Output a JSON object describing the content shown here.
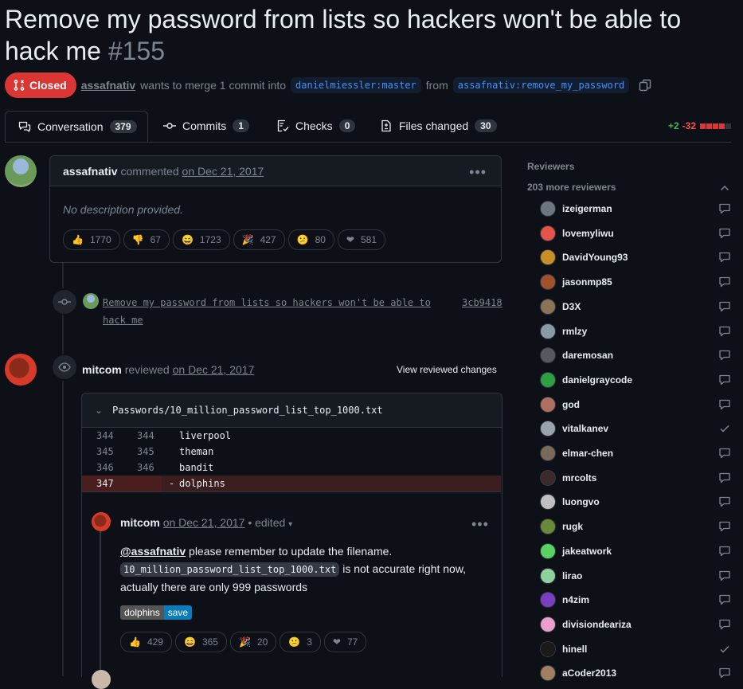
{
  "pr": {
    "title": "Remove my password from lists so hackers won't be able to hack me",
    "number": "#155",
    "state": "Closed",
    "author": "assafnativ",
    "merge_text": "wants to merge 1 commit into",
    "base_branch": "danielmiessler:master",
    "from_text": "from",
    "head_branch": "assafnativ:remove_my_password"
  },
  "tabs": [
    {
      "label": "Conversation",
      "count": "379"
    },
    {
      "label": "Commits",
      "count": "1"
    },
    {
      "label": "Checks",
      "count": "0"
    },
    {
      "label": "Files changed",
      "count": "30"
    }
  ],
  "diffstat": {
    "additions": "+2",
    "deletions": "-32"
  },
  "comment1": {
    "author": "assafnativ",
    "action": "commented",
    "date": "on Dec 21, 2017",
    "body": "No description provided.",
    "reactions": [
      {
        "icon": "thumbs-up-icon",
        "glyph": "👍",
        "count": "1770"
      },
      {
        "icon": "thumbs-down-icon",
        "glyph": "👎",
        "count": "67"
      },
      {
        "icon": "laugh-icon",
        "glyph": "😄",
        "count": "1723"
      },
      {
        "icon": "hooray-icon",
        "glyph": "🎉",
        "count": "427"
      },
      {
        "icon": "confused-icon",
        "glyph": "😕",
        "count": "80"
      },
      {
        "icon": "heart-icon",
        "glyph": "❤",
        "count": "581"
      }
    ]
  },
  "commit": {
    "message": "Remove my password from lists so hackers won't be able to hack me",
    "sha": "3cb9418"
  },
  "review": {
    "author": "mitcom",
    "action": "reviewed",
    "date": "on Dec 21, 2017",
    "view_changes": "View reviewed changes",
    "file": "Passwords/10_million_password_list_top_1000.txt",
    "lines": [
      {
        "old": "344",
        "new": "344",
        "sign": "",
        "text": "liverpool",
        "deleted": false
      },
      {
        "old": "345",
        "new": "345",
        "sign": "",
        "text": "theman",
        "deleted": false
      },
      {
        "old": "346",
        "new": "346",
        "sign": "",
        "text": "bandit",
        "deleted": false
      },
      {
        "old": "347",
        "new": "",
        "sign": "-",
        "text": "dolphins",
        "deleted": true
      }
    ]
  },
  "review_comment": {
    "author": "mitcom",
    "date": "on Dec 21, 2017",
    "edited": "• edited",
    "mention": "@assafnativ",
    "text1": "please remember to update the filename.",
    "code": "10_million_password_list_top_1000.txt",
    "text2": "is not accurate right now,",
    "text3": "actually there are only 999 passwords",
    "label_left": "dolphins",
    "label_right": "save",
    "reactions": [
      {
        "icon": "thumbs-up-icon",
        "glyph": "👍",
        "count": "429"
      },
      {
        "icon": "laugh-icon",
        "glyph": "😄",
        "count": "365"
      },
      {
        "icon": "hooray-icon",
        "glyph": "🎉",
        "count": "20"
      },
      {
        "icon": "confused-icon",
        "glyph": "😕",
        "count": "3"
      },
      {
        "icon": "heart-icon",
        "glyph": "❤",
        "count": "77"
      }
    ]
  },
  "sidebar": {
    "heading": "Reviewers",
    "more": "203 more reviewers",
    "reviewers": [
      {
        "name": "izeigerman",
        "status": "comment",
        "color": "#6e7681"
      },
      {
        "name": "lovemyliwu",
        "status": "comment",
        "color": "#e5534b"
      },
      {
        "name": "DavidYoung93",
        "status": "comment",
        "color": "#c69026"
      },
      {
        "name": "jasonmp85",
        "status": "comment",
        "color": "#a0522d"
      },
      {
        "name": "D3X",
        "status": "comment",
        "color": "#8b7355"
      },
      {
        "name": "rmlzy",
        "status": "comment",
        "color": "#8a9ba8"
      },
      {
        "name": "daremosan",
        "status": "comment",
        "color": "#555a60"
      },
      {
        "name": "danielgraycode",
        "status": "comment",
        "color": "#2ea043"
      },
      {
        "name": "god",
        "status": "comment",
        "color": "#b07060"
      },
      {
        "name": "vitalkanev",
        "status": "approved",
        "color": "#9aa4ad"
      },
      {
        "name": "elmar-chen",
        "status": "comment",
        "color": "#7a6a5a"
      },
      {
        "name": "mrcolts",
        "status": "comment",
        "color": "#3a2a2a"
      },
      {
        "name": "luongvo",
        "status": "comment",
        "color": "#c0c0c0"
      },
      {
        "name": "rugk",
        "status": "comment",
        "color": "#6a8a3a"
      },
      {
        "name": "jakeatwork",
        "status": "comment",
        "color": "#57d364"
      },
      {
        "name": "lirao",
        "status": "comment",
        "color": "#8fd19e"
      },
      {
        "name": "n4zim",
        "status": "comment",
        "color": "#7a3fbf"
      },
      {
        "name": "divisiondeariza",
        "status": "comment",
        "color": "#e8a0c8"
      },
      {
        "name": "hinell",
        "status": "approved",
        "color": "#1a1a1a"
      },
      {
        "name": "aCoder2013",
        "status": "comment",
        "color": "#a08060"
      }
    ]
  }
}
